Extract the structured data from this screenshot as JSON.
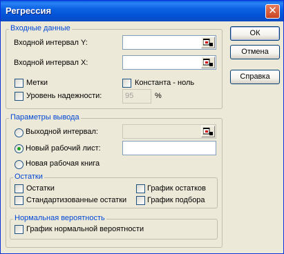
{
  "window": {
    "title": "Регрессия",
    "close_glyph": "✕"
  },
  "input_group": {
    "legend": "Входные данные",
    "y_range_label": "Входной интервал Y:",
    "x_range_label": "Входной интервал X:",
    "labels_checkbox": "Метки",
    "constant_zero_checkbox": "Константа - ноль",
    "confidence_label": "Уровень надежности:",
    "confidence_value": "95",
    "confidence_unit": "%"
  },
  "output_group": {
    "legend": "Параметры вывода",
    "output_range_label": "Выходной интервал:",
    "new_sheet_label": "Новый рабочий лист:",
    "new_workbook_label": "Новая рабочая книга",
    "selected": "new_sheet"
  },
  "residuals_group": {
    "legend": "Остатки",
    "residuals": "Остатки",
    "standardized_residuals": "Стандартизованные остатки",
    "residual_plots": "График остатков",
    "line_fit_plots": "График подбора"
  },
  "normal_group": {
    "legend": "Нормальная вероятность",
    "normal_plot": "График нормальной вероятности"
  },
  "buttons": {
    "ok": "ОК",
    "cancel": "Отмена",
    "help": "Справка"
  },
  "colors": {
    "title_bar": "#0a5fe0",
    "group_legend": "#0046d5",
    "dialog_bg": "#ece9d8",
    "radio_dot": "#21a121"
  },
  "icons": {
    "ref_edit": "collapse-dialog-icon"
  }
}
